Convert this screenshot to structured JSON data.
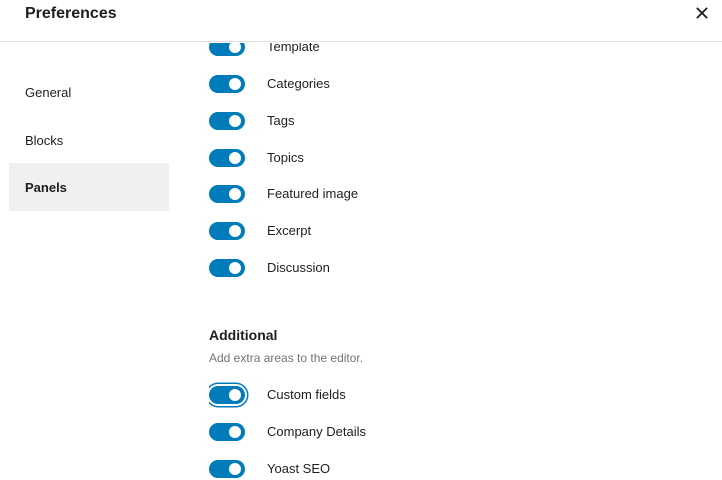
{
  "header": {
    "title": "Preferences",
    "close_icon": "close-icon"
  },
  "sidebar": {
    "items": [
      {
        "label": "General",
        "active": false
      },
      {
        "label": "Blocks",
        "active": false
      },
      {
        "label": "Panels",
        "active": true
      }
    ]
  },
  "panels": {
    "document_options": [
      {
        "label": "Template",
        "checked": true
      },
      {
        "label": "Categories",
        "checked": true
      },
      {
        "label": "Tags",
        "checked": true
      },
      {
        "label": "Topics",
        "checked": true
      },
      {
        "label": "Featured image",
        "checked": true
      },
      {
        "label": "Excerpt",
        "checked": true
      },
      {
        "label": "Discussion",
        "checked": true
      }
    ],
    "additional": {
      "title": "Additional",
      "description": "Add extra areas to the editor.",
      "options": [
        {
          "label": "Custom fields",
          "checked": true,
          "focused": true
        },
        {
          "label": "Company Details",
          "checked": true
        },
        {
          "label": "Yoast SEO",
          "checked": true
        }
      ]
    }
  },
  "colors": {
    "accent": "#007cba",
    "active_tab_bg": "#f0f0f0",
    "muted_text": "#757575"
  }
}
